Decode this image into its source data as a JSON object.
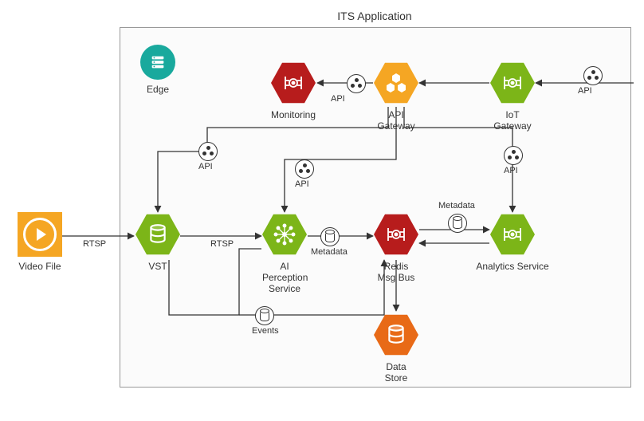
{
  "title": "ITS Application",
  "nodes": {
    "video_file": "Video File",
    "edge": "Edge",
    "vst": "VST",
    "monitoring": "Monitoring",
    "api_gateway": "API Gateway",
    "iot_gateway": "IoT Gateway",
    "ai_perception": "AI Perception Service",
    "redis": "Redis Msg Bus",
    "analytics": "Analytics Service",
    "data_store": "Data Store"
  },
  "edge_labels": {
    "rtsp1": "RTSP",
    "rtsp2": "RTSP",
    "api": "API",
    "metadata": "Metadata",
    "events": "Events"
  },
  "edges": [
    {
      "from": "video_file",
      "to": "vst",
      "label": "rtsp1"
    },
    {
      "from": "vst",
      "to": "ai_perception",
      "label": "rtsp2"
    },
    {
      "from": "ai_perception",
      "to": "redis",
      "label": "metadata"
    },
    {
      "from": "redis",
      "to": "analytics",
      "label": "metadata"
    },
    {
      "from": "analytics",
      "to": "redis"
    },
    {
      "from": "redis",
      "to": "data_store"
    },
    {
      "from": "api_gateway",
      "to": "monitoring",
      "label": "api"
    },
    {
      "from": "iot_gateway",
      "to": "api_gateway"
    },
    {
      "from": "external",
      "to": "iot_gateway",
      "label": "api"
    },
    {
      "from": "api_gateway",
      "to": "vst",
      "label": "api"
    },
    {
      "from": "api_gateway",
      "to": "ai_perception",
      "label": "api"
    },
    {
      "from": "api_gateway",
      "to": "analytics",
      "label": "api"
    },
    {
      "from": "vst",
      "to": "redis",
      "label": "events",
      "note": "via lower path"
    },
    {
      "from": "vst",
      "to": "ai_perception",
      "note": "lower input"
    }
  ],
  "colors": {
    "green": "#7cb518",
    "red": "#b71c1c",
    "amber": "#f5a623",
    "orange": "#e86a17",
    "teal": "#19a99d"
  }
}
